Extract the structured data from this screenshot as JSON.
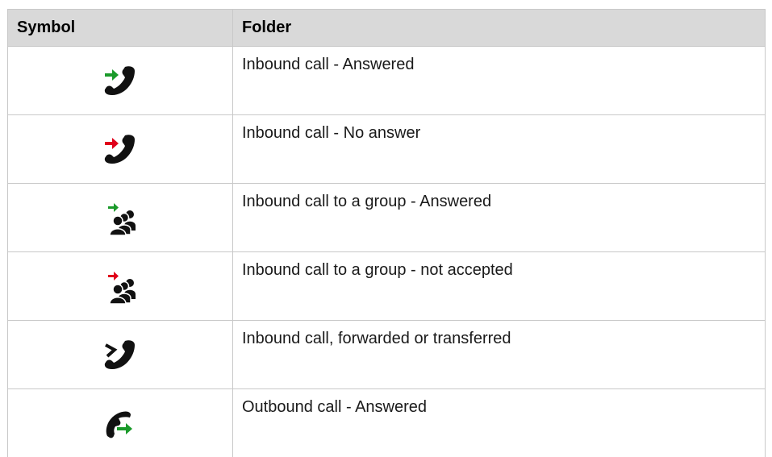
{
  "table": {
    "header": {
      "symbol": "Symbol",
      "folder": "Folder"
    },
    "rows": [
      {
        "icon": "inbound-answered-icon",
        "arrow_color": "#1a9a2a",
        "label": "Inbound call - Answered"
      },
      {
        "icon": "inbound-no-answer-icon",
        "arrow_color": "#e0001a",
        "label": "Inbound call - No answer"
      },
      {
        "icon": "inbound-group-answered-icon",
        "arrow_color": "#1a9a2a",
        "label": "Inbound call to a group - Answered"
      },
      {
        "icon": "inbound-group-not-accepted-icon",
        "arrow_color": "#e0001a",
        "label": "Inbound call to a group - not accepted"
      },
      {
        "icon": "inbound-forwarded-icon",
        "arrow_color": "#000000",
        "label": "Inbound call, forwarded or transferred"
      },
      {
        "icon": "outbound-answered-icon",
        "arrow_color": "#1a9a2a",
        "label": "Outbound call - Answered"
      }
    ]
  }
}
